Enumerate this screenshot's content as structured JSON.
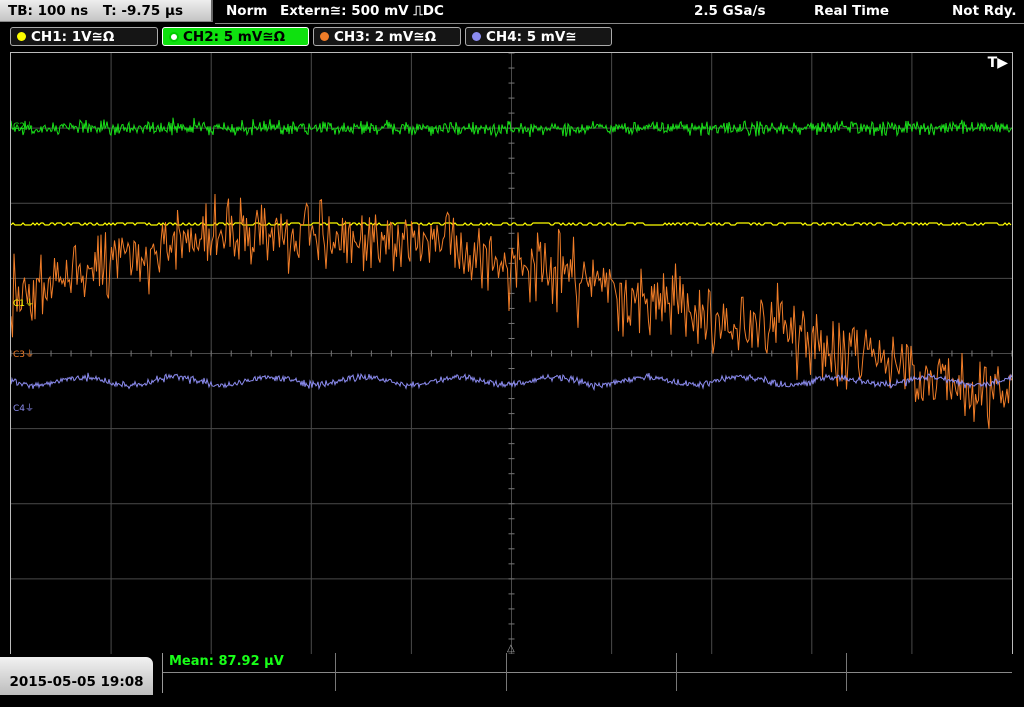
{
  "status_bar": {
    "timebase": "TB: 100 ns",
    "trigger_time": "T: -9.75 µs",
    "mode": "Norm",
    "trigger_source": "Extern≅: 500 mV ⎍DC",
    "sample_rate": "2.5 GSa/s",
    "acq_mode": "Real Time",
    "trigger_state": "Not Rdy."
  },
  "channels": [
    {
      "label": "CH1: 1V≅Ω",
      "color": "#ffff00",
      "active": false
    },
    {
      "label": "CH2: 5 mV≅Ω",
      "color": "#19e019",
      "active": true
    },
    {
      "label": "CH3: 2 mV≅Ω",
      "color": "#f07d28",
      "active": false
    },
    {
      "label": "CH4: 5 mV≅",
      "color": "#8c8cf0",
      "active": false
    }
  ],
  "markers": {
    "c2": "C2⏚",
    "c1": "C1⏚",
    "c3": "C3⏚",
    "c4": "C4⏚",
    "trigger_arrow": "T▶",
    "trigger_bottom": "△"
  },
  "measurement": {
    "mean": "Mean: 87.92 µV"
  },
  "timestamp": "2015-05-05 19:08",
  "colors": {
    "grid": "#4a4a4a",
    "ch1": "#ffff00",
    "ch2": "#19e019",
    "ch3": "#f07d28",
    "ch4": "#8c8cf0"
  }
}
